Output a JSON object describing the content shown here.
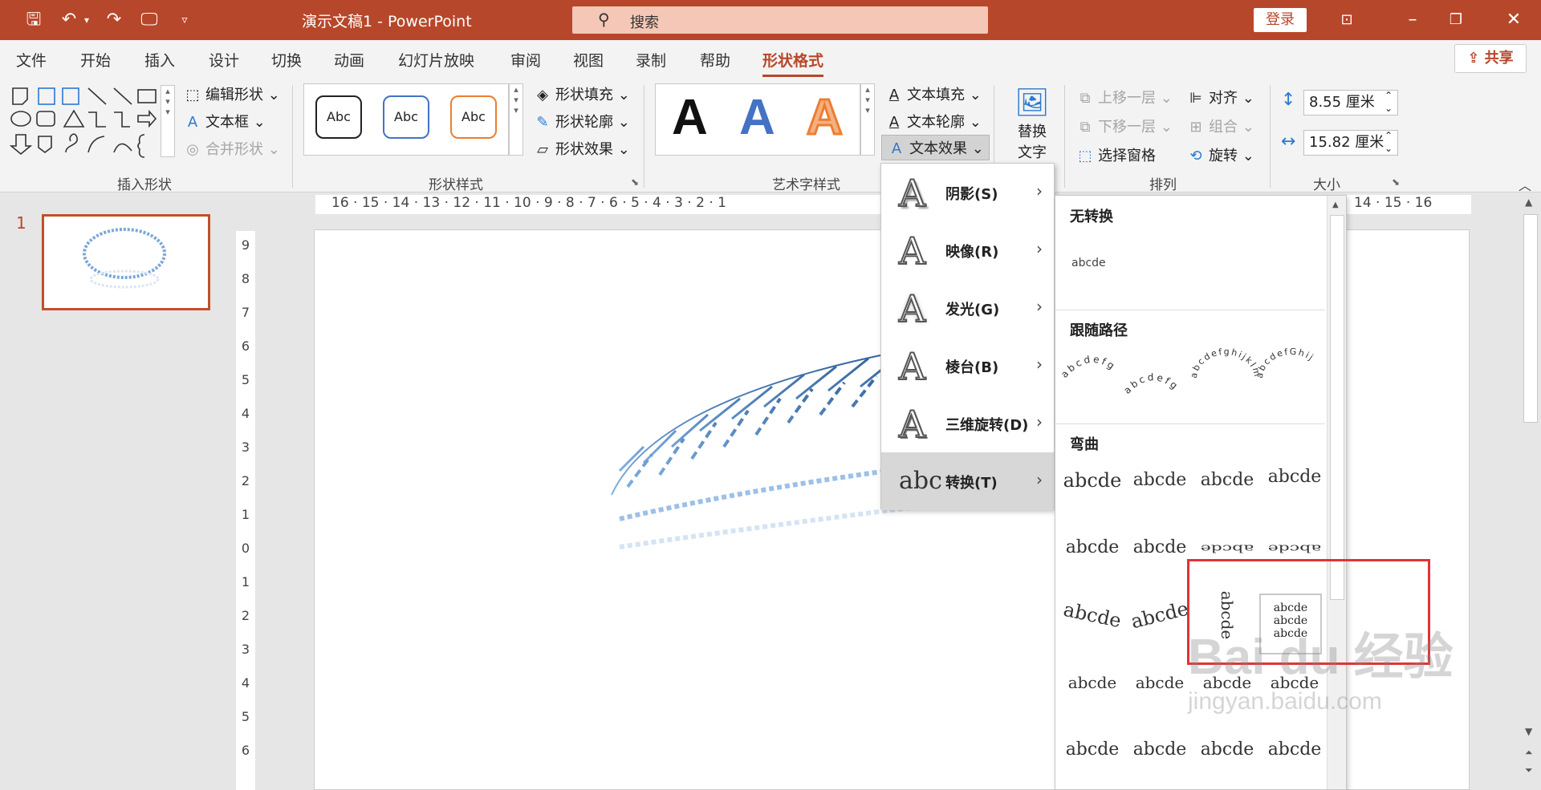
{
  "titlebar": {
    "doc_title": "演示文稿1  -  PowerPoint",
    "search_placeholder": "搜索",
    "login_label": "登录"
  },
  "tabs": [
    {
      "label": "文件"
    },
    {
      "label": "开始"
    },
    {
      "label": "插入"
    },
    {
      "label": "设计"
    },
    {
      "label": "切换"
    },
    {
      "label": "动画"
    },
    {
      "label": "幻灯片放映"
    },
    {
      "label": "审阅"
    },
    {
      "label": "视图"
    },
    {
      "label": "录制"
    },
    {
      "label": "帮助"
    },
    {
      "label": "形状格式"
    }
  ],
  "share_label": "共享",
  "ribbon": {
    "insert_shapes": {
      "group_label": "插入形状",
      "edit_shape": "编辑形状",
      "text_box": "文本框",
      "merge_shapes": "合并形状"
    },
    "shape_styles": {
      "group_label": "形状样式",
      "preset_labels": [
        "Abc",
        "Abc",
        "Abc"
      ],
      "fill": "形状填充",
      "outline": "形状轮廓",
      "effects": "形状效果"
    },
    "wordart": {
      "group_label": "艺术字样式",
      "letter": "A",
      "text_fill": "文本填充",
      "text_outline": "文本轮廓",
      "text_effects": "文本效果"
    },
    "accessibility": {
      "alt_text_line1": "替换",
      "alt_text_line2": "文字"
    },
    "arrange": {
      "group_label": "排列",
      "bring_forward": "上移一层",
      "send_backward": "下移一层",
      "selection_pane": "选择窗格",
      "align": "对齐",
      "group": "组合",
      "rotate": "旋转"
    },
    "size": {
      "group_label": "大小",
      "height": "8.55 厘米",
      "width": "15.82 厘米"
    }
  },
  "slide_panel": {
    "slide_number": "1"
  },
  "hruler_text": "16 · 15 · 14 · 13 · 12 · 11 · 10 · 9 · 8 · 7 · 6 · 5 · 4 · 3 · 2 · 1",
  "hruler_right": "14 · 15 · 16",
  "vruler_ticks": [
    "9",
    "8",
    "7",
    "6",
    "5",
    "4",
    "3",
    "2",
    "1",
    "0",
    "1",
    "2",
    "3",
    "4",
    "5",
    "6"
  ],
  "text_effects_menu": [
    {
      "label": "阴影(S)"
    },
    {
      "label": "映像(R)"
    },
    {
      "label": "发光(G)"
    },
    {
      "label": "棱台(B)"
    },
    {
      "label": "三维旋转(D)"
    },
    {
      "label": "转换(T)"
    }
  ],
  "transform_gallery": {
    "no_transform_heading": "无转换",
    "no_transform_sample": "abcde",
    "follow_path_heading": "跟随路径",
    "warp_heading": "弯曲",
    "warp_sample": "abcde",
    "path_samples": [
      "abcdefg",
      "abcdefg",
      "abcdefghijklm",
      "abcdefGhij"
    ],
    "selected_sample": "abcde"
  },
  "watermark": {
    "brand": "Bai du 经验",
    "url": "jingyan.baidu.com"
  },
  "colors": {
    "accent": "#b7472a",
    "highlight_box": "#e03434"
  }
}
